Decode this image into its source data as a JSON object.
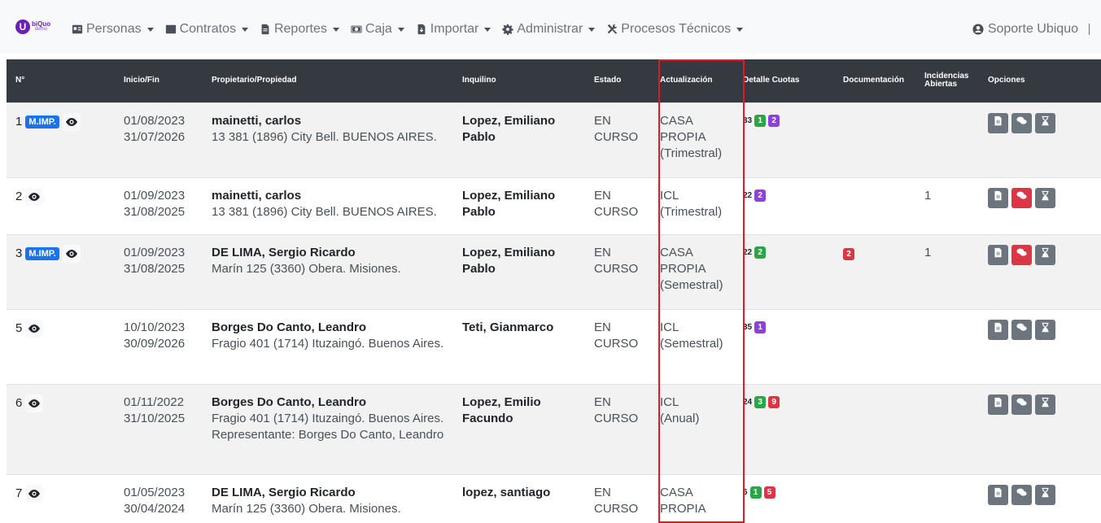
{
  "brand": {
    "initial": "U",
    "name": "biQuo",
    "sub": "demo"
  },
  "nav": {
    "items": [
      {
        "label": "Personas",
        "icon": "id-card-icon"
      },
      {
        "label": "Contratos",
        "icon": "square-icon"
      },
      {
        "label": "Reportes",
        "icon": "document-icon"
      },
      {
        "label": "Caja",
        "icon": "money-icon"
      },
      {
        "label": "Importar",
        "icon": "import-icon"
      },
      {
        "label": "Administrar",
        "icon": "gear-icon"
      },
      {
        "label": "Procesos Técnicos",
        "icon": "tools-icon"
      }
    ],
    "user": "Soporte Ubiquo"
  },
  "table": {
    "headers": [
      "N°",
      "Inicio/Fin",
      "Propietario/Propiedad",
      "Inquilino",
      "Estado",
      "Actualización",
      "Detalle Cuotas",
      "Documentación",
      "Incidencias Abiertas",
      "Opciones"
    ],
    "rows": [
      {
        "num": "1",
        "mimp": "M.IMP.",
        "inicio": "01/08/2023",
        "fin": "31/07/2026",
        "propietario": "mainetti, carlos",
        "propiedad": [
          "13 381 (1896) City Bell. BUENOS AIRES."
        ],
        "inquilino": "Lopez, Emiliano Pablo",
        "estado": "EN CURSO",
        "actualizacion": [
          "CASA",
          "PROPIA",
          "(Trimestral)"
        ],
        "cuotas_num": "33",
        "cuotas": [
          {
            "v": "1",
            "c": "green"
          },
          {
            "v": "2",
            "c": "purple"
          }
        ],
        "doc": "",
        "incidencias": "",
        "chat_alert": false
      },
      {
        "num": "2",
        "mimp": "",
        "inicio": "01/09/2023",
        "fin": "31/08/2025",
        "propietario": "mainetti, carlos",
        "propiedad": [
          "13 381 (1896) City Bell. BUENOS AIRES."
        ],
        "inquilino": "Lopez, Emiliano Pablo",
        "estado": "EN CURSO",
        "actualizacion": [
          "ICL",
          "(Trimestral)"
        ],
        "cuotas_num": "22",
        "cuotas": [
          {
            "v": "2",
            "c": "purple"
          }
        ],
        "doc": "",
        "incidencias": "1",
        "chat_alert": true
      },
      {
        "num": "3",
        "mimp": "M.IMP.",
        "inicio": "01/09/2023",
        "fin": "31/08/2025",
        "propietario": "DE LIMA, Sergio Ricardo",
        "propiedad": [
          "Marín 125 (3360) Obera. Misiones."
        ],
        "inquilino": "Lopez, Emiliano Pablo",
        "estado": "EN CURSO",
        "actualizacion": [
          "CASA",
          "PROPIA",
          "(Semestral)"
        ],
        "cuotas_num": "22",
        "cuotas": [
          {
            "v": "2",
            "c": "green"
          }
        ],
        "doc": "2",
        "incidencias": "1",
        "chat_alert": true
      },
      {
        "num": "5",
        "mimp": "",
        "inicio": "10/10/2023",
        "fin": "30/09/2026",
        "propietario": "Borges Do Canto, Leandro",
        "propiedad": [
          "Fragio 401 (1714) Ituzaingó. Buenos Aires."
        ],
        "inquilino": "Teti, Gianmarco",
        "estado": "EN CURSO",
        "actualizacion": [
          "ICL",
          "(Semestral)"
        ],
        "cuotas_num": "35",
        "cuotas": [
          {
            "v": "1",
            "c": "purple"
          }
        ],
        "doc": "",
        "incidencias": "",
        "chat_alert": false
      },
      {
        "num": "6",
        "mimp": "",
        "inicio": "01/11/2022",
        "fin": "31/10/2025",
        "propietario": "Borges Do Canto, Leandro",
        "propiedad": [
          "Fragio 401 (1714) Ituzaingó. Buenos Aires.",
          "Representante: Borges Do Canto, Leandro"
        ],
        "inquilino": "Lopez, Emilio Facundo",
        "estado": "EN CURSO",
        "actualizacion": [
          "ICL",
          "(Anual)"
        ],
        "cuotas_num": "24",
        "cuotas": [
          {
            "v": "3",
            "c": "green"
          },
          {
            "v": "9",
            "c": "red"
          }
        ],
        "doc": "",
        "incidencias": "",
        "chat_alert": false
      },
      {
        "num": "7",
        "mimp": "",
        "inicio": "01/05/2023",
        "fin": "30/04/2024",
        "propietario": "DE LIMA, Sergio Ricardo",
        "propiedad": [
          "Marín 125 (3360) Obera. Misiones."
        ],
        "inquilino": "lopez, santiago",
        "estado": "EN CURSO",
        "actualizacion": [
          "CASA",
          "PROPIA"
        ],
        "cuotas_num": "6",
        "cuotas": [
          {
            "v": "1",
            "c": "green"
          },
          {
            "v": "5",
            "c": "red"
          }
        ],
        "doc": "",
        "incidencias": "",
        "chat_alert": false
      }
    ]
  },
  "colors": {
    "navbar": "#f8f9fa",
    "header": "#343a40",
    "highlight": "#e01b1b",
    "mimp": "#1a73e8"
  }
}
